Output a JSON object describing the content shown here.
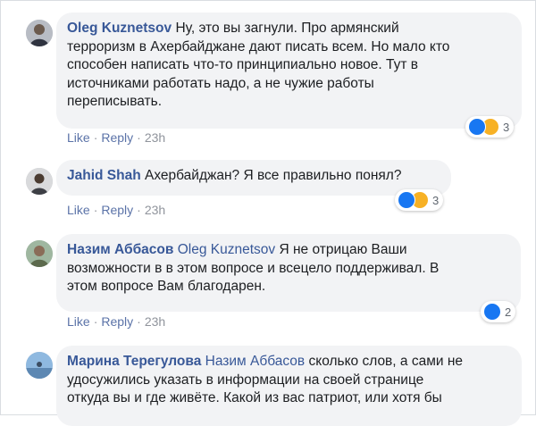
{
  "comments": [
    {
      "author": "Oleg Kuznetsov",
      "mention": "",
      "text": "Ну, это вы загнули. Про армянский терроризм в Ахербайджане дают писать всем. Но мало кто способен написать что-то принципиально новое. Тут в источниками работать надо, а не чужие работы переписывать.",
      "lines": [
        "Ну, это вы загнули. Про армянский",
        "терроризм в Ахербайджане дают писать всем. Но мало кто",
        "способен написать что-то принципиально новое. Тут в",
        "источниками работать надо, а не чужие работы",
        "переписывать."
      ],
      "like": "Like",
      "reply": "Reply",
      "time": "23h",
      "reaction_icons": [
        "like-icon",
        "haha-icon"
      ],
      "reaction_count": "3"
    },
    {
      "author": "Jahid Shah",
      "mention": "",
      "text": "Ахербайджан? Я все правильно понял?",
      "lines": [
        "Ахербайджан? Я все правильно понял?"
      ],
      "like": "Like",
      "reply": "Reply",
      "time": "23h",
      "reaction_icons": [
        "like-icon",
        "haha-icon"
      ],
      "reaction_count": "3"
    },
    {
      "author": "Назим Аббасов",
      "mention": "Oleg Kuznetsov",
      "text": "Я не отрицаю Ваши возможности в в этом вопросе и всецело поддерживал. В этом вопросе Вам благодарен.",
      "lines": [
        "Я не отрицаю Ваши",
        "возможности в в этом вопросе и всецело поддерживал. В",
        "этом вопросе Вам благодарен."
      ],
      "like": "Like",
      "reply": "Reply",
      "time": "23h",
      "reaction_icons": [
        "like-icon"
      ],
      "reaction_count": "2"
    },
    {
      "author": "Марина Терегулова",
      "mention": "Назим Аббасов",
      "text": "сколько слов, а сами не удосужились указать в информации на своей странице откуда вы и где живёте. Какой из вас патриот, или хотя бы",
      "lines": [
        "сколько слов, а сами не",
        "удосужились указать в информации на своей странице",
        "откуда вы и где живёте. Какой из вас патриот, или хотя бы"
      ]
    }
  ],
  "colors": {
    "author": "#385898",
    "bubble": "#f2f3f5",
    "like_reaction": "#1877f2",
    "haha_reaction": "#f7b125"
  }
}
